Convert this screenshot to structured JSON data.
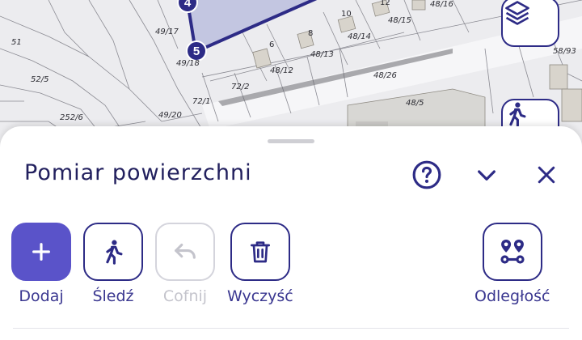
{
  "map": {
    "parcel_labels": [
      "51",
      "52/5",
      "252/6",
      "49/17",
      "49/18",
      "49/20",
      "72/1",
      "72/2",
      "48/12",
      "48/13",
      "48/14",
      "48/15",
      "48/16",
      "48/26",
      "48/5",
      "58/93"
    ],
    "house_numbers": [
      "6",
      "8",
      "10",
      "12"
    ],
    "measurement_vertices": [
      "4",
      "5"
    ],
    "accent_color": "#2d2b86",
    "polygon_fill": "rgba(120,130,200,0.35)"
  },
  "map_buttons": {
    "layers_icon": "layers-icon",
    "walk_icon": "walking-person-icon"
  },
  "sheet": {
    "title": "Pomiar powierzchni",
    "help_icon": "help-circle-icon",
    "collapse_icon": "chevron-down-icon",
    "close_icon": "close-icon"
  },
  "tools": [
    {
      "label": "Dodaj",
      "icon": "plus-icon",
      "state": "active"
    },
    {
      "label": "Śledź",
      "icon": "walking-person-icon",
      "state": "enabled"
    },
    {
      "label": "Cofnij",
      "icon": "undo-icon",
      "state": "disabled"
    },
    {
      "label": "Wyczyść",
      "icon": "trash-icon",
      "state": "enabled"
    },
    {
      "label": "Odległość",
      "icon": "route-distance-icon",
      "state": "enabled"
    }
  ],
  "colors": {
    "primary": "#5a53c9",
    "text": "#22205e",
    "disabled": "#c4c4cc"
  }
}
